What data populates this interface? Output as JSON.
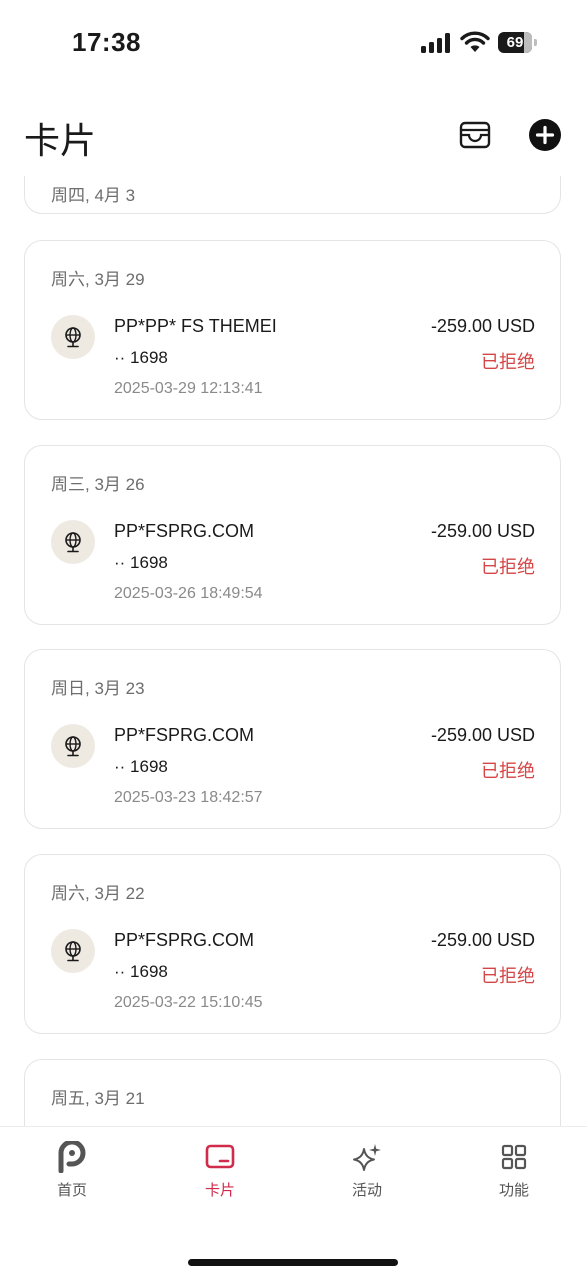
{
  "status_bar": {
    "time": "17:38",
    "battery": "69"
  },
  "header": {
    "title": "卡片"
  },
  "partial_top_card": {
    "date": "周四, 4月 3"
  },
  "transactions": [
    {
      "date": "周六, 3月 29",
      "merchant": "PP*PP* FS THEMEI",
      "card_last4": "·· 1698",
      "timestamp": "2025-03-29 12:13:41",
      "amount": "-259.00 USD",
      "status": "已拒绝"
    },
    {
      "date": "周三, 3月 26",
      "merchant": "PP*FSPRG.COM",
      "card_last4": "·· 1698",
      "timestamp": "2025-03-26 18:49:54",
      "amount": "-259.00 USD",
      "status": "已拒绝"
    },
    {
      "date": "周日, 3月 23",
      "merchant": "PP*FSPRG.COM",
      "card_last4": "·· 1698",
      "timestamp": "2025-03-23 18:42:57",
      "amount": "-259.00 USD",
      "status": "已拒绝"
    },
    {
      "date": "周六, 3月 22",
      "merchant": "PP*FSPRG.COM",
      "card_last4": "·· 1698",
      "timestamp": "2025-03-22 15:10:45",
      "amount": "-259.00 USD",
      "status": "已拒绝"
    }
  ],
  "partial_bottom_card": {
    "date": "周五, 3月 21"
  },
  "tab_bar": {
    "items": [
      {
        "label": "首页",
        "icon": "app-logo-icon"
      },
      {
        "label": "卡片",
        "icon": "card-icon",
        "active": true
      },
      {
        "label": "活动",
        "icon": "sparkle-icon"
      },
      {
        "label": "功能",
        "icon": "grid-icon"
      }
    ]
  },
  "colors": {
    "accent": "#d02b4a",
    "declined": "#d64545",
    "icon_bg": "#eeeae2"
  }
}
